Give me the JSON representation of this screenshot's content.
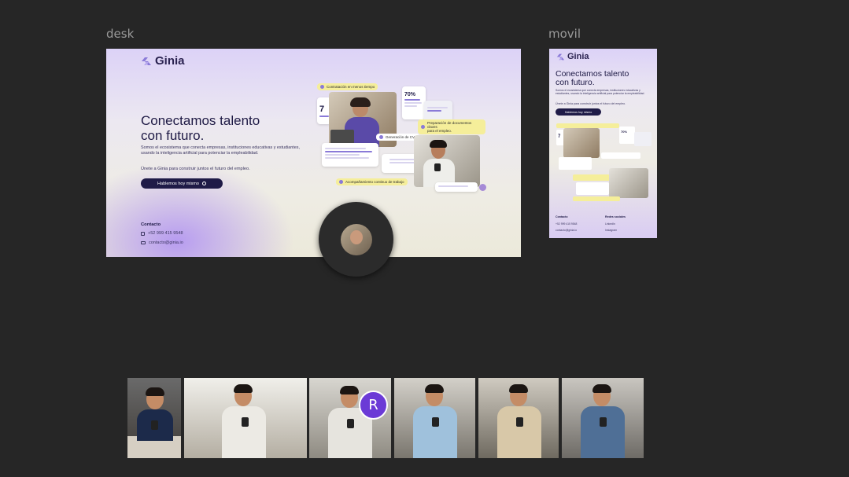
{
  "frames": {
    "desk_label": "desk",
    "movil_label": "movil"
  },
  "brand": {
    "name": "Ginia",
    "accent": "#8a7ad8",
    "dark": "#1f1b47",
    "highlight": "#f5ee9a"
  },
  "hero": {
    "title_line1": "Conectamos talento",
    "title_line2": "con futuro.",
    "description": "Somos el ecosistema que conecta empresas, instituciones educativas y estudiantes, usando la inteligencia artificial para potenciar la empleabilidad.",
    "cta_text": "Únete a Ginia para construir juntos el futuro del empleo.",
    "cta_button": "Hablemos hoy mismo"
  },
  "collage": {
    "pill_contratacion": "Contratación en menos tiempo",
    "pill_preparacion_line1": "Preparación de documentos claves",
    "pill_preparacion_line2": "para el empleo.",
    "pill_generacion": "Generación de CVs",
    "pill_acompanamiento": "Acompañamiento continuo de trabajo",
    "stat_number": "7",
    "stat_percent": "70%"
  },
  "contact": {
    "title": "Contacto",
    "phone": "+52 999 415 9548",
    "email": "contacto@ginia.io"
  },
  "mobile": {
    "phone": "+52 999 415 9548",
    "email": "contacto@ginia.io",
    "social_title": "Redes sociales",
    "social_linkedin": "LinkedIn",
    "social_instagram": "Instagram"
  },
  "recorder": {
    "avatar_letter": "R",
    "avatar_color": "#6b3ad6"
  }
}
